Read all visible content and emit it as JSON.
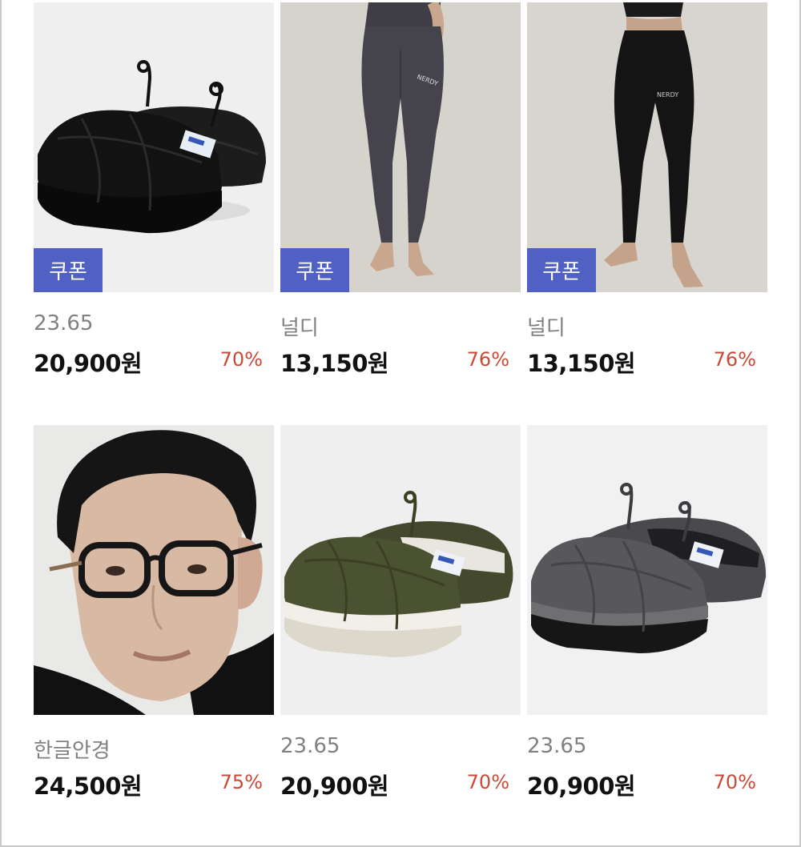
{
  "products": [
    {
      "brand": "23.65",
      "price": "20,900원",
      "discount": "70%",
      "coupon": "쿠폰",
      "image": "black-quilted-slipper",
      "bg": "#efefef"
    },
    {
      "brand": "널디",
      "price": "13,150원",
      "discount": "76%",
      "coupon": "쿠폰",
      "image": "charcoal-leggings",
      "bg": "#d6d2cc"
    },
    {
      "brand": "널디",
      "price": "13,150원",
      "discount": "76%",
      "coupon": "쿠폰",
      "image": "black-leggings",
      "bg": "#d8d4cf"
    },
    {
      "brand": "한글안경",
      "price": "24,500원",
      "discount": "75%",
      "image": "man-with-glasses",
      "bg": "#e9e9e7"
    },
    {
      "brand": "23.65",
      "price": "20,900원",
      "discount": "70%",
      "image": "olive-quilted-slipper",
      "bg": "#efefef"
    },
    {
      "brand": "23.65",
      "price": "20,900원",
      "discount": "70%",
      "image": "gray-quilted-slipper",
      "bg": "#f1f1f1"
    }
  ],
  "colors": {
    "coupon_bg": "#5160c3",
    "discount": "#c94a35"
  }
}
